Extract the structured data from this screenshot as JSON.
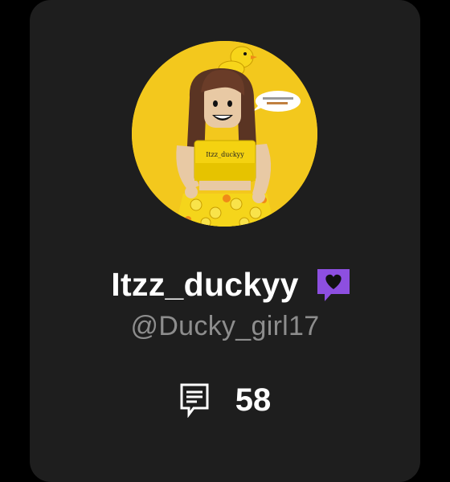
{
  "profile": {
    "display_name": "Itzz_duckyy",
    "handle": "@Ducky_girl17",
    "avatar_shirt_text": "Itzz_duckyy",
    "badge_icon": "heart-chat-badge-icon",
    "comment_icon": "comment-icon",
    "comment_count": "58"
  },
  "colors": {
    "card_background": "#1e1e1e",
    "page_background": "#000000",
    "avatar_background": "#f3c81d",
    "badge_purple": "#8d4fe0",
    "name_text": "#ffffff",
    "handle_text": "#8d8d8d"
  }
}
